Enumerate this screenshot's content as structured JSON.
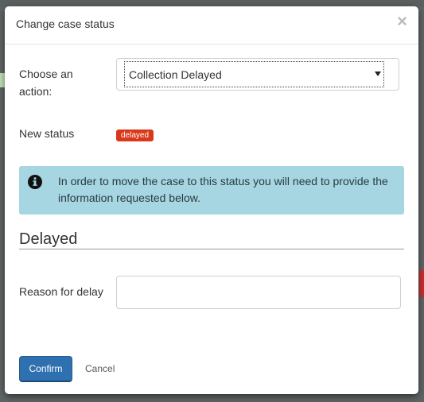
{
  "modal": {
    "title": "Change case status",
    "close_label": "×"
  },
  "form": {
    "action_label": "Choose an action:",
    "action_selected": "Collection Delayed",
    "new_status_label": "New status",
    "new_status_badge": "delayed",
    "badge_color": "#d9391a"
  },
  "alert": {
    "icon": "info-icon",
    "text": "In order to move the case to this status you will need to provide the information requested below.",
    "color": "#a6d6e2"
  },
  "section": {
    "title": "Delayed",
    "reason_label": "Reason for delay",
    "reason_value": ""
  },
  "footer": {
    "confirm_label": "Confirm",
    "cancel_label": "Cancel",
    "confirm_color": "#2f70b0"
  }
}
